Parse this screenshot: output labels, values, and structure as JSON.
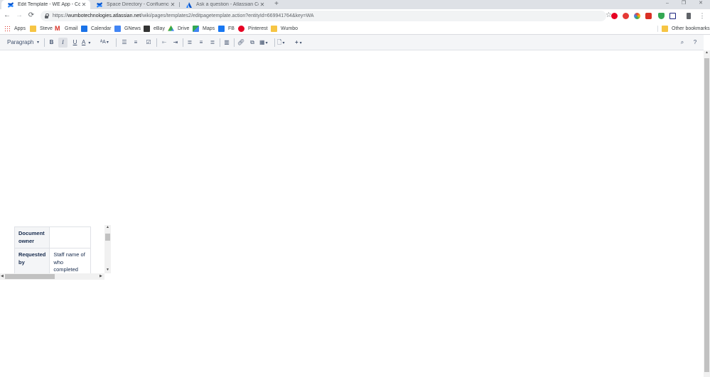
{
  "tabs": [
    {
      "title": "Edit Template - WE App - Confluence",
      "active": true
    },
    {
      "title": "Space Directory - Confluence",
      "active": false
    },
    {
      "title": "Ask a question - Atlassian Community",
      "active": false
    }
  ],
  "window_controls": {
    "minimize": "–",
    "restore": "❐",
    "close": "✕"
  },
  "address": {
    "scheme": "https://",
    "host": "wumbotechnologies.atlassian.net",
    "path": "/wiki/pages/templates2/editpagetemplate.action?entityId=669941764&key=WA"
  },
  "bookmarks": [
    {
      "label": "Apps",
      "icon": "apps-grid-icon",
      "color": "#d93025"
    },
    {
      "label": "Steve",
      "icon": "folder-icon",
      "color": "#f6c544"
    },
    {
      "label": "Gmail",
      "icon": "gmail-icon",
      "color": "#d93025"
    },
    {
      "label": "Calendar",
      "icon": "calendar-icon",
      "color": "#1a73e8"
    },
    {
      "label": "GNews",
      "icon": "gnews-icon",
      "color": "#4285f4"
    },
    {
      "label": "eBay",
      "icon": "ebay-icon",
      "color": "#333333"
    },
    {
      "label": "Drive",
      "icon": "drive-icon",
      "color": "#34a853"
    },
    {
      "label": "Maps",
      "icon": "maps-icon",
      "color": "#34a853"
    },
    {
      "label": "FB",
      "icon": "facebook-icon",
      "color": "#1877f2"
    },
    {
      "label": "Pinterest",
      "icon": "pinterest-icon",
      "color": "#e60023"
    },
    {
      "label": "Wumbo",
      "icon": "folder-icon",
      "color": "#f6c544"
    }
  ],
  "other_bookmarks": "Other bookmarks",
  "editor_toolbar": {
    "style_select": "Paragraph",
    "bold": "B",
    "italic": "I",
    "underline": "U",
    "text_color": "A",
    "font_size": "ᴬA",
    "help": "?"
  },
  "table": {
    "rows": [
      {
        "header": "Document owner",
        "value": ""
      },
      {
        "header": "Requested by",
        "value": "Staff name of who completed"
      }
    ]
  }
}
